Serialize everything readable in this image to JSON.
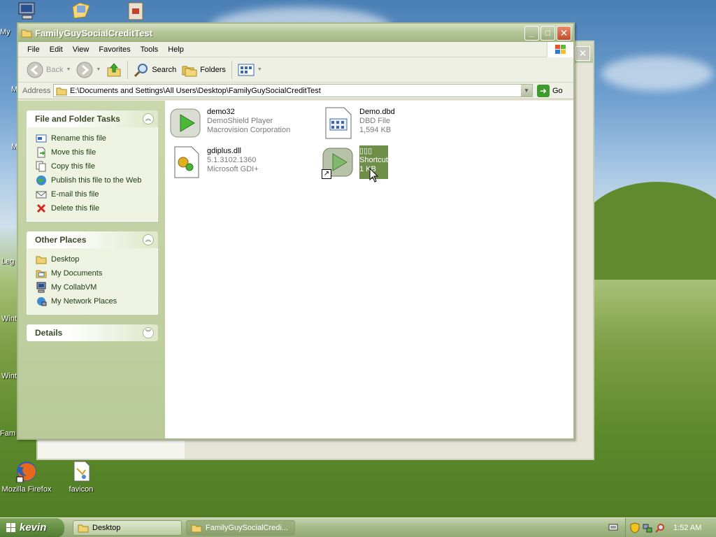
{
  "desktop": {
    "icons": [
      {
        "label": "Mozilla Firefox",
        "icon": "firefox-icon"
      },
      {
        "label": "favicon",
        "icon": "image-file-icon"
      }
    ],
    "partial_labels": [
      "My",
      "M",
      "M",
      "Leg",
      "Wint",
      "Wint",
      "Fam"
    ]
  },
  "window": {
    "title": "FamilyGuySocialCreditTest",
    "menu": [
      "File",
      "Edit",
      "View",
      "Favorites",
      "Tools",
      "Help"
    ],
    "toolbar": {
      "back": "Back",
      "search": "Search",
      "folders": "Folders"
    },
    "address": {
      "label": "Address",
      "value": "E:\\Documents and Settings\\All Users\\Desktop\\FamilyGuySocialCreditTest",
      "go": "Go"
    }
  },
  "taskpane": {
    "file_tasks": {
      "title": "File and Folder Tasks",
      "items": [
        {
          "label": "Rename this file",
          "icon": "rename-icon"
        },
        {
          "label": "Move this file",
          "icon": "move-icon"
        },
        {
          "label": "Copy this file",
          "icon": "copy-icon"
        },
        {
          "label": "Publish this file to the Web",
          "icon": "globe-icon"
        },
        {
          "label": "E-mail this file",
          "icon": "email-icon"
        },
        {
          "label": "Delete this file",
          "icon": "delete-icon"
        }
      ]
    },
    "other_places": {
      "title": "Other Places",
      "items": [
        {
          "label": "Desktop",
          "icon": "folder-icon"
        },
        {
          "label": "My Documents",
          "icon": "documents-icon"
        },
        {
          "label": "My CollabVM",
          "icon": "computer-icon"
        },
        {
          "label": "My Network Places",
          "icon": "network-icon"
        }
      ]
    },
    "details": {
      "title": "Details"
    }
  },
  "files": [
    {
      "name": "demo32",
      "line2": "DemoShield Player",
      "line3": "Macrovision Corporation",
      "icon": "play-icon"
    },
    {
      "name": "Demo.dbd",
      "line2": "DBD File",
      "line3": "1,594 KB",
      "icon": "document-icon"
    },
    {
      "name": "gdiplus.dll",
      "line2": "5.1.3102.1360",
      "line3": "Microsoft GDI+",
      "icon": "dll-icon"
    },
    {
      "name": "▯▯▯",
      "line2": "Shortcut",
      "line3": "1 KB",
      "icon": "play-shortcut-icon"
    }
  ],
  "taskbar": {
    "start": "kevin",
    "tasks": [
      "Desktop",
      "FamilyGuySocialCredi..."
    ],
    "clock": "1:52 AM"
  },
  "colors": {
    "titlebar": "#a1b582",
    "taskpane": "#c9d7ad",
    "selection": "#6e8e4a"
  }
}
